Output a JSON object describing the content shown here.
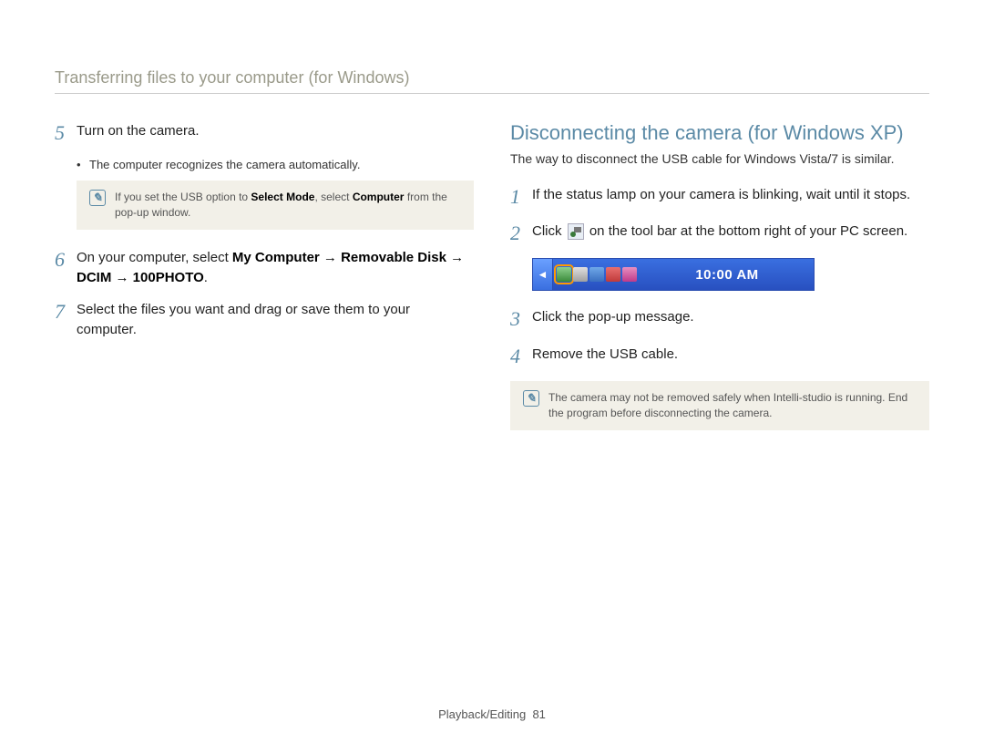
{
  "header": "Transferring files to your computer (for Windows)",
  "left": {
    "step5": {
      "num": "5",
      "text": "Turn on the camera."
    },
    "bullet5": "The computer recognizes the camera automatically.",
    "note1_pre": "If you set the USB option to ",
    "note1_b1": "Select Mode",
    "note1_mid": ", select ",
    "note1_b2": "Computer",
    "note1_post": " from the pop-up window.",
    "step6": {
      "num": "6",
      "pre": "On your computer, select ",
      "path": "My Computer → Removable Disk → DCIM → 100PHOTO",
      "post": "."
    },
    "step7": {
      "num": "7",
      "text": "Select the files you want and drag or save them to your computer."
    }
  },
  "right": {
    "heading": "Disconnecting the camera (for Windows XP)",
    "sub": "The way to disconnect the USB cable for Windows Vista/7 is similar.",
    "step1": {
      "num": "1",
      "text": "If the status lamp on your camera is blinking, wait until it stops."
    },
    "step2": {
      "num": "2",
      "pre": "Click ",
      "post": " on the tool bar at the bottom right of your PC screen."
    },
    "taskbar_time": "10:00 AM",
    "step3": {
      "num": "3",
      "text": "Click the pop-up message."
    },
    "step4": {
      "num": "4",
      "text": "Remove the USB cable."
    },
    "note2": "The camera may not be removed safely when Intelli-studio is running. End the program before disconnecting the camera."
  },
  "footer": {
    "section": "Playback/Editing",
    "page": "81"
  }
}
